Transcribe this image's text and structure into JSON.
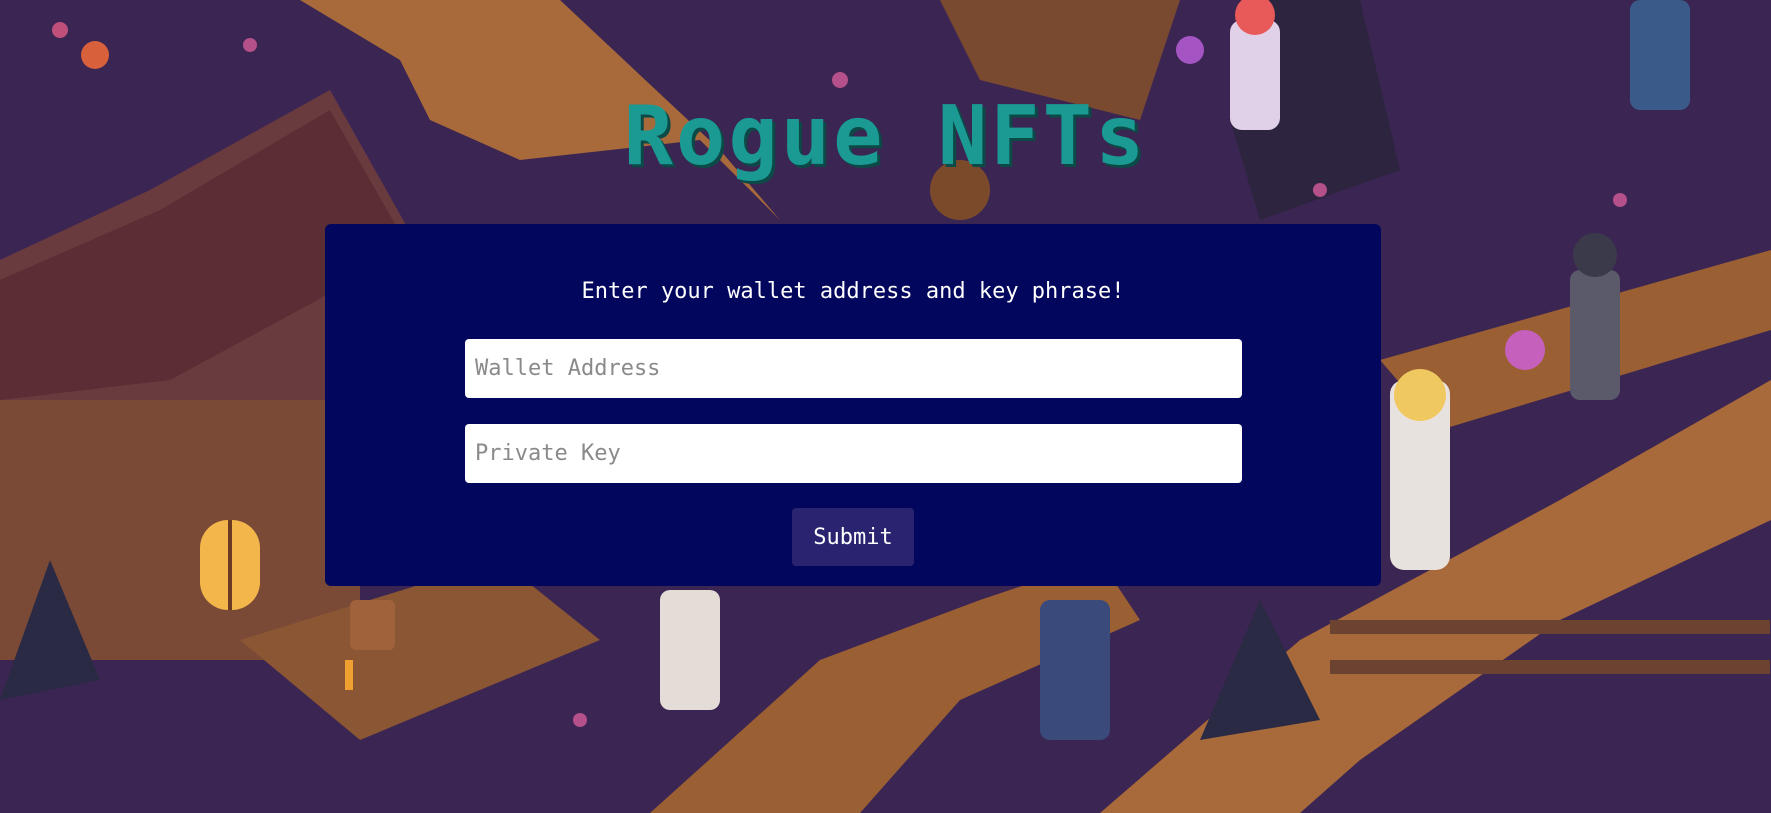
{
  "page": {
    "title": "Rogue NFTs"
  },
  "form": {
    "prompt": "Enter your wallet address and key phrase!",
    "wallet_placeholder": "Wallet Address",
    "wallet_value": "",
    "key_placeholder": "Private Key",
    "key_value": "",
    "submit_label": "Submit"
  },
  "colors": {
    "title": "#1a9a92",
    "panel": "#02065c",
    "button": "#2a2470",
    "background": "#3b2552"
  },
  "background": {
    "description_icon": "pixel-art-village-scene"
  }
}
